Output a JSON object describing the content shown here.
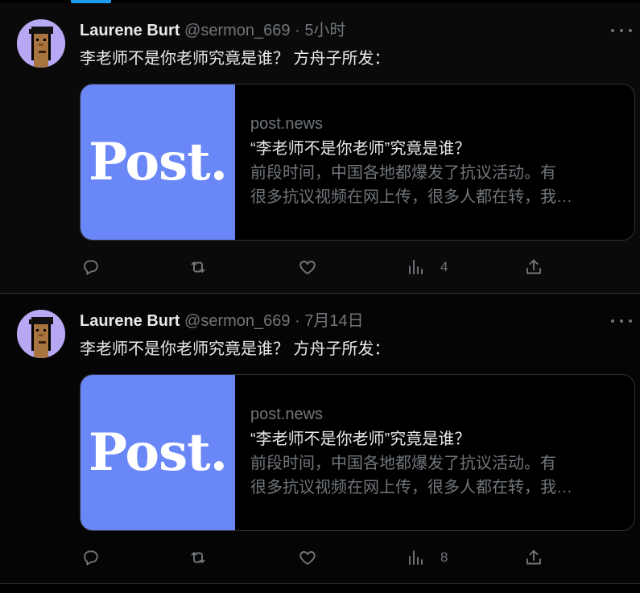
{
  "tweets": [
    {
      "display_name": "Laurene Burt",
      "handle": "@sermon_669",
      "separator": "·",
      "time": "5小时",
      "text": "李老师不是你老师究竟是谁？ 方舟子所发：",
      "card": {
        "logo": "Post.",
        "domain": "post.news",
        "title": "“李老师不是你老师”究竟是谁？",
        "desc_line1": "前段时间，中国各地都爆发了抗议活动。有",
        "desc_line2": "很多抗议视频在网上传，很多人都在转，我…"
      },
      "views": "4"
    },
    {
      "display_name": "Laurene Burt",
      "handle": "@sermon_669",
      "separator": "·",
      "time": "7月14日",
      "text": "李老师不是你老师究竟是谁？ 方舟子所发：",
      "card": {
        "logo": "Post.",
        "domain": "post.news",
        "title": "“李老师不是你老师”究竟是谁？",
        "desc_line1": "前段时间，中国各地都爆发了抗议活动。有",
        "desc_line2": "很多抗议视频在网上传，很多人都在转，我…"
      },
      "views": "8"
    }
  ],
  "icons": {
    "reply": "reply-icon",
    "retweet": "retweet-icon",
    "like": "heart-icon",
    "views": "analytics-icon",
    "share": "share-icon",
    "more": "more-icon"
  },
  "colors": {
    "background": "#000000",
    "text_primary": "#e7e9ea",
    "text_secondary": "#71767b",
    "accent": "#1d9bf0",
    "card_thumb": "#6a87f8",
    "avatar_bg": "#b8a8f4"
  }
}
